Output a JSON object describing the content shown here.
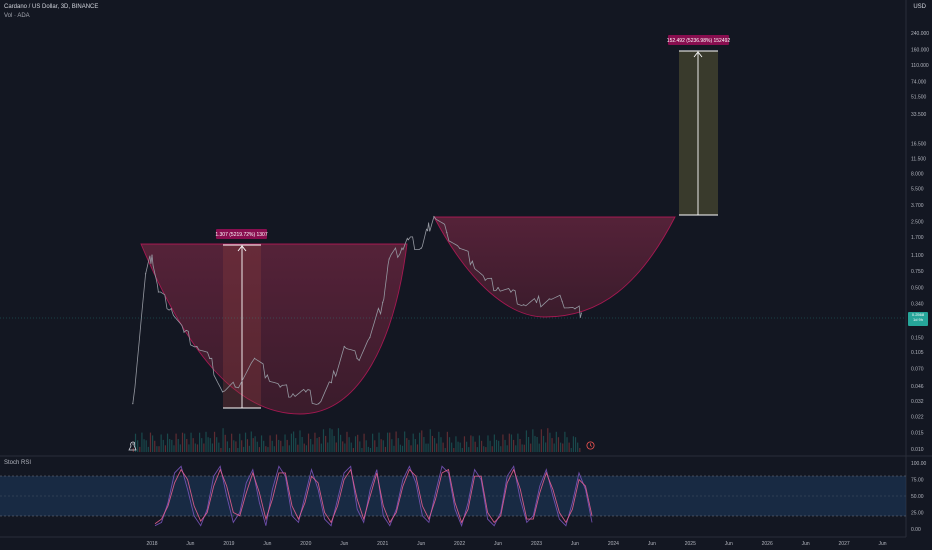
{
  "header": {
    "title": "Cardano / US Dollar, 3D, BINANCE",
    "volume_label": "Vol · ADA"
  },
  "currency": "USD",
  "current_price": {
    "value": "0.2568",
    "countdown": "1d 9h",
    "color": "#26a69a"
  },
  "colors": {
    "background": "#131722",
    "cup_fill": "#7a2a44",
    "cup_stroke": "#c2185b",
    "target_fill": "#3a3a28",
    "measure_label_bg": "#880e4f",
    "rsi_k": "#7e57c2",
    "rsi_d": "#f06292",
    "rsi_band": "#1e3a5f"
  },
  "measures": [
    {
      "label": "1.307 (5219.72%) 1307"
    },
    {
      "label": "152.492 (5236.98%) 152492"
    }
  ],
  "rsi_panel": {
    "label": "Stoch RSI"
  },
  "chart_data": [
    {
      "type": "line",
      "title": "Cardano / US Dollar, 3D, BINANCE",
      "xlabel": "",
      "ylabel": "USD",
      "log_scale": true,
      "ylim": [
        0.01,
        240
      ],
      "y_ticks": [
        "240.000",
        "160.000",
        "110.000",
        "74.000",
        "51.500",
        "33.500",
        "16.500",
        "11.500",
        "8.000",
        "5.500",
        "3.700",
        "2.500",
        "1.700",
        "1.100",
        "0.750",
        "0.500",
        "0.340",
        "0.150",
        "0.105",
        "0.070",
        "0.046",
        "0.032",
        "0.022",
        "0.015",
        "0.010"
      ],
      "x_ticks": [
        "2018",
        "Jun",
        "2019",
        "Jun",
        "2020",
        "Jun",
        "2021",
        "Jun",
        "2022",
        "Jun",
        "2023",
        "Jun",
        "2024",
        "Jun",
        "2025",
        "Jun",
        "2026",
        "Jun",
        "2027",
        "Jun"
      ],
      "series": [
        {
          "name": "ADAUSD",
          "x": [
            "2017-10",
            "2017-12",
            "2018-01",
            "2018-02",
            "2018-04",
            "2018-06",
            "2018-08",
            "2018-10",
            "2018-12",
            "2019-02",
            "2019-05",
            "2019-07",
            "2019-09",
            "2019-11",
            "2020-01",
            "2020-03",
            "2020-05",
            "2020-07",
            "2020-09",
            "2020-11",
            "2021-01",
            "2021-02",
            "2021-04",
            "2021-05",
            "2021-07",
            "2021-08",
            "2021-09",
            "2021-11",
            "2022-01",
            "2022-03",
            "2022-05",
            "2022-07",
            "2022-09",
            "2022-11",
            "2023-01",
            "2023-03",
            "2023-05",
            "2023-07",
            "2023-08"
          ],
          "values": [
            0.03,
            0.7,
            1.1,
            0.45,
            0.3,
            0.17,
            0.12,
            0.09,
            0.04,
            0.045,
            0.09,
            0.06,
            0.045,
            0.038,
            0.04,
            0.03,
            0.05,
            0.12,
            0.09,
            0.15,
            0.35,
            1.0,
            1.3,
            1.6,
            1.3,
            2.0,
            2.8,
            1.9,
            1.3,
            0.95,
            0.6,
            0.5,
            0.45,
            0.33,
            0.35,
            0.38,
            0.36,
            0.3,
            0.27
          ]
        }
      ],
      "annotations": [
        {
          "type": "cup",
          "from": "2017-12",
          "to": "2021-02",
          "rim": 1.307,
          "bottom": 0.023
        },
        {
          "type": "cup",
          "from": "2021-09",
          "to": "2024-08",
          "rim": 2.5,
          "bottom": 0.24
        },
        {
          "type": "measure",
          "label": "1.307 (5219.72%) 1307",
          "from": 0.023,
          "to": 1.307
        },
        {
          "type": "measure",
          "label": "152.492 (5236.98%) 152492",
          "from": 2.5,
          "to": 152.492
        }
      ]
    },
    {
      "type": "line",
      "title": "Stoch RSI",
      "ylim": [
        0,
        100
      ],
      "y_ticks": [
        "100.00",
        "75.00",
        "50.00",
        "25.00",
        "0.00"
      ],
      "series": [
        {
          "name": "K",
          "values": [
            5,
            10,
            40,
            85,
            95,
            60,
            20,
            5,
            30,
            80,
            95,
            50,
            10,
            25,
            70,
            90,
            40,
            5,
            60,
            95,
            80,
            20,
            10,
            50,
            90,
            60,
            15,
            5,
            45,
            85,
            95,
            30,
            10,
            60,
            90,
            20,
            5,
            30,
            75,
            95,
            70,
            20,
            10,
            55,
            95,
            85,
            30,
            5,
            40,
            90,
            75,
            15,
            5,
            25,
            80,
            95,
            45,
            10,
            20,
            65,
            90,
            50,
            15,
            5,
            40,
            85,
            60,
            10
          ]
        },
        {
          "name": "D",
          "values": [
            8,
            15,
            35,
            70,
            90,
            75,
            35,
            12,
            25,
            65,
            90,
            65,
            25,
            20,
            55,
            85,
            55,
            15,
            45,
            85,
            85,
            35,
            15,
            40,
            80,
            70,
            25,
            10,
            35,
            75,
            90,
            45,
            15,
            50,
            85,
            35,
            10,
            25,
            65,
            90,
            80,
            35,
            15,
            45,
            85,
            90,
            40,
            10,
            30,
            80,
            80,
            25,
            10,
            20,
            70,
            90,
            60,
            15,
            15,
            55,
            85,
            60,
            25,
            10,
            30,
            75,
            65,
            20
          ]
        }
      ],
      "band": [
        20,
        80
      ]
    }
  ]
}
